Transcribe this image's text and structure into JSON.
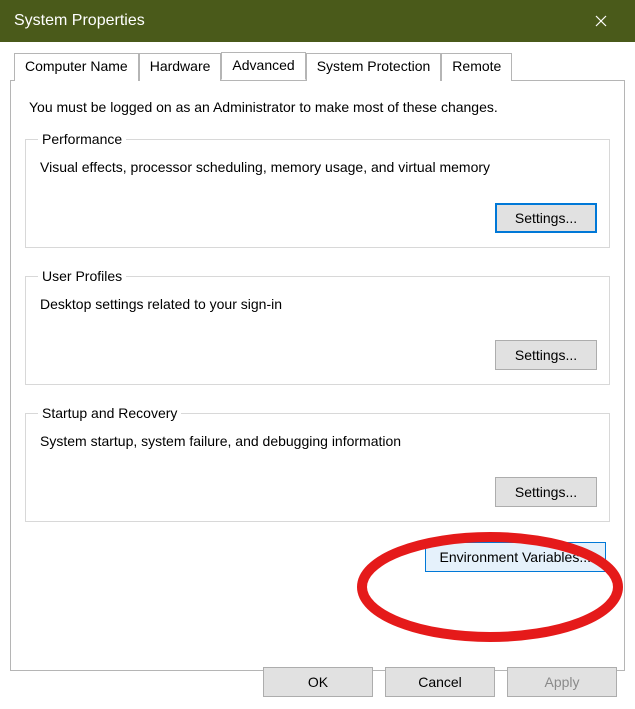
{
  "window": {
    "title": "System Properties"
  },
  "tabs": {
    "computer_name": "Computer Name",
    "hardware": "Hardware",
    "advanced": "Advanced",
    "system_protection": "System Protection",
    "remote": "Remote"
  },
  "intro": "You must be logged on as an Administrator to make most of these changes.",
  "groups": {
    "performance": {
      "legend": "Performance",
      "desc": "Visual effects, processor scheduling, memory usage, and virtual memory",
      "button": "Settings..."
    },
    "user_profiles": {
      "legend": "User Profiles",
      "desc": "Desktop settings related to your sign-in",
      "button": "Settings..."
    },
    "startup": {
      "legend": "Startup and Recovery",
      "desc": "System startup, system failure, and debugging information",
      "button": "Settings..."
    }
  },
  "env_button": "Environment Variables...",
  "dialog_buttons": {
    "ok": "OK",
    "cancel": "Cancel",
    "apply": "Apply"
  }
}
